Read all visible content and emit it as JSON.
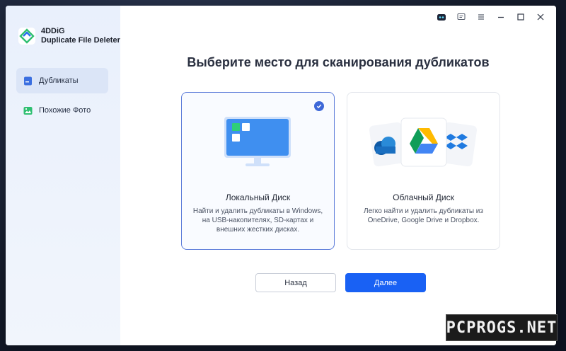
{
  "app": {
    "brand_line1": "4DDiG",
    "brand_line2": "Duplicate File Deleter"
  },
  "sidebar": {
    "items": [
      {
        "label": "Дубликаты",
        "icon": "file-icon",
        "active": true
      },
      {
        "label": "Похожие Фото",
        "icon": "image-icon",
        "active": false
      }
    ]
  },
  "titlebar": {
    "icons": [
      "robot-icon",
      "feedback-icon",
      "menu-icon",
      "minimize-icon",
      "maximize-icon",
      "close-icon"
    ]
  },
  "main": {
    "heading": "Выберите место для сканирования дубликатов",
    "cards": [
      {
        "title": "Локальный Диск",
        "description": "Найти и удалить дубликаты в Windows, на USB-накопителях, SD-картах и внешних жестких дисках.",
        "selected": true,
        "icon": "monitor-icon"
      },
      {
        "title": "Облачный Диск",
        "description": "Легко найти и удалить дубликаты из OneDrive, Google Drive и Dropbox.",
        "selected": false,
        "icon": "cloud-services-icon"
      }
    ],
    "back_label": "Назад",
    "next_label": "Далее"
  },
  "watermark": "PCPROGS.NET",
  "colors": {
    "accent": "#1961f4",
    "selected_border": "#5b7bd9",
    "sidebar_bg": "#e9f0fc"
  }
}
